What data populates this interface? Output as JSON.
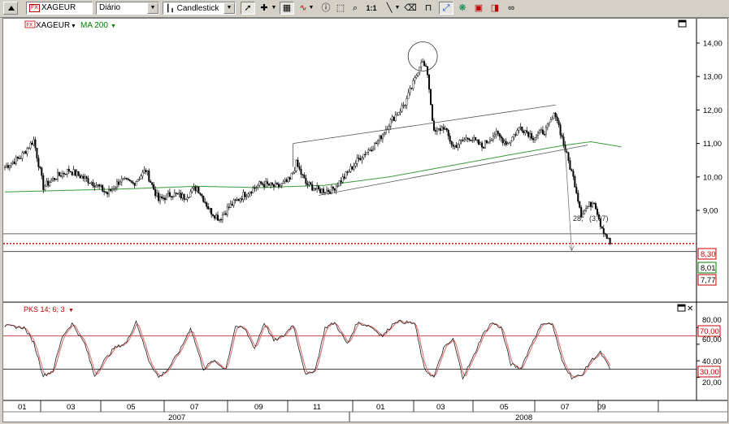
{
  "toolbar": {
    "symbol_badge": "FX",
    "symbol": "XAGEUR",
    "period": "Diário",
    "chart_style": "Candlestick",
    "icons": [
      "cursor-arrow-icon",
      "crosshair-icon",
      "grid-toggle-icon",
      "line-style-icon",
      "info-icon",
      "zoom-area-icon",
      "zoom-icon",
      "ratio-icon",
      "line-tool-icon",
      "eraser-icon",
      "magnet-icon",
      "pattern-icon",
      "snapshot-icon",
      "link-icon"
    ]
  },
  "main_pane": {
    "legend_symbol": "XAGEUR",
    "legend_symbol_badge": "FX",
    "legend_ma": "MA 200",
    "annotation": "28,   (3,07)",
    "price_badges": [
      {
        "value": "8,30",
        "color": "#c00000"
      },
      {
        "value": "8,01",
        "color": "#008000"
      },
      {
        "value": "7,77",
        "color": "#c00000"
      }
    ]
  },
  "osc_pane": {
    "legend": "PKS 14; 6; 3",
    "axis_labels": [
      "80,00",
      "60,00",
      "40,00",
      "20,00"
    ],
    "level_badges": [
      "70,00",
      "30,00"
    ]
  },
  "time_axis": {
    "months": [
      "01",
      "03",
      "05",
      "07",
      "09",
      "11",
      "01",
      "03",
      "05",
      "07",
      "09"
    ],
    "years": [
      "2007",
      "2008"
    ]
  },
  "chart_data": [
    {
      "type": "candlestick",
      "series": [
        {
          "name": "XAGEUR"
        },
        {
          "name": "MA 200"
        }
      ],
      "yticks": [
        "14,00",
        "13,00",
        "12,00",
        "11,00",
        "10,00",
        "9,00"
      ],
      "ylim": [
        7.5,
        14.5
      ],
      "close_anchors": [
        [
          0,
          10.3
        ],
        [
          10,
          10.6
        ],
        [
          18,
          11.1
        ],
        [
          24,
          9.7
        ],
        [
          32,
          10.0
        ],
        [
          40,
          10.2
        ],
        [
          48,
          10.0
        ],
        [
          56,
          9.8
        ],
        [
          64,
          9.5
        ],
        [
          72,
          9.9
        ],
        [
          80,
          9.8
        ],
        [
          88,
          10.2
        ],
        [
          96,
          9.3
        ],
        [
          104,
          9.5
        ],
        [
          112,
          9.4
        ],
        [
          120,
          9.7
        ],
        [
          128,
          9.0
        ],
        [
          134,
          8.75
        ],
        [
          140,
          9.1
        ],
        [
          150,
          9.5
        ],
        [
          160,
          9.8
        ],
        [
          170,
          9.7
        ],
        [
          178,
          9.9
        ],
        [
          182,
          10.4
        ],
        [
          188,
          9.8
        ],
        [
          196,
          9.6
        ],
        [
          204,
          9.6
        ],
        [
          212,
          10.0
        ],
        [
          222,
          10.6
        ],
        [
          232,
          11.0
        ],
        [
          240,
          11.6
        ],
        [
          250,
          12.2
        ],
        [
          256,
          12.9
        ],
        [
          260,
          13.5
        ],
        [
          264,
          13.1
        ],
        [
          268,
          11.3
        ],
        [
          274,
          11.5
        ],
        [
          280,
          10.9
        ],
        [
          290,
          11.2
        ],
        [
          298,
          10.9
        ],
        [
          306,
          11.3
        ],
        [
          314,
          11.0
        ],
        [
          322,
          11.5
        ],
        [
          330,
          11.2
        ],
        [
          338,
          11.4
        ],
        [
          344,
          11.9
        ],
        [
          350,
          10.8
        ],
        [
          356,
          9.8
        ],
        [
          360,
          8.9
        ],
        [
          364,
          9.1
        ],
        [
          368,
          9.3
        ],
        [
          372,
          8.6
        ],
        [
          378,
          8.0
        ]
      ],
      "ma_anchors": [
        [
          0,
          9.55
        ],
        [
          40,
          9.6
        ],
        [
          80,
          9.65
        ],
        [
          120,
          9.72
        ],
        [
          160,
          9.68
        ],
        [
          200,
          9.75
        ],
        [
          240,
          10.0
        ],
        [
          280,
          10.35
        ],
        [
          320,
          10.7
        ],
        [
          350,
          10.95
        ],
        [
          366,
          11.05
        ],
        [
          385,
          10.9
        ]
      ],
      "lines": {
        "h_8_30": 8.3,
        "h_8_01": 8.01,
        "h_7_77": 7.77
      }
    },
    {
      "type": "line",
      "series": [
        {
          "name": "PKS 14; 6; 3"
        }
      ],
      "ylim": [
        0,
        100
      ],
      "levels": [
        70,
        30
      ],
      "anchors": [
        [
          0,
          82
        ],
        [
          12,
          80
        ],
        [
          18,
          62
        ],
        [
          24,
          22
        ],
        [
          30,
          28
        ],
        [
          36,
          70
        ],
        [
          42,
          85
        ],
        [
          50,
          60
        ],
        [
          56,
          22
        ],
        [
          62,
          40
        ],
        [
          68,
          55
        ],
        [
          76,
          62
        ],
        [
          82,
          88
        ],
        [
          90,
          40
        ],
        [
          96,
          20
        ],
        [
          102,
          30
        ],
        [
          110,
          55
        ],
        [
          116,
          80
        ],
        [
          124,
          30
        ],
        [
          130,
          40
        ],
        [
          138,
          30
        ],
        [
          144,
          82
        ],
        [
          150,
          78
        ],
        [
          156,
          55
        ],
        [
          162,
          86
        ],
        [
          168,
          64
        ],
        [
          174,
          70
        ],
        [
          180,
          84
        ],
        [
          188,
          22
        ],
        [
          194,
          30
        ],
        [
          200,
          80
        ],
        [
          206,
          86
        ],
        [
          214,
          60
        ],
        [
          220,
          86
        ],
        [
          228,
          82
        ],
        [
          236,
          70
        ],
        [
          244,
          88
        ],
        [
          256,
          85
        ],
        [
          262,
          30
        ],
        [
          268,
          20
        ],
        [
          274,
          55
        ],
        [
          280,
          66
        ],
        [
          286,
          20
        ],
        [
          292,
          42
        ],
        [
          298,
          70
        ],
        [
          304,
          86
        ],
        [
          310,
          80
        ],
        [
          316,
          36
        ],
        [
          322,
          30
        ],
        [
          330,
          65
        ],
        [
          336,
          86
        ],
        [
          342,
          84
        ],
        [
          348,
          40
        ],
        [
          354,
          20
        ],
        [
          360,
          22
        ],
        [
          366,
          40
        ],
        [
          372,
          50
        ],
        [
          378,
          30
        ]
      ]
    }
  ]
}
